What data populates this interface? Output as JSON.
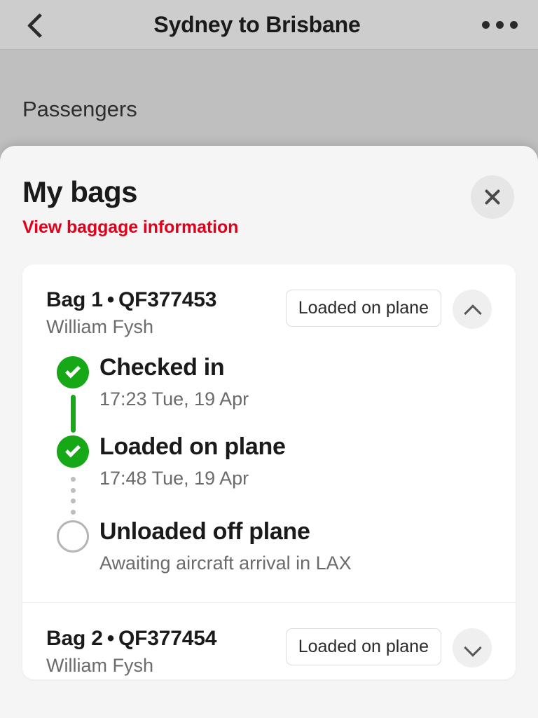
{
  "navbar": {
    "back_icon": "chevron-left-icon",
    "title": "Sydney to Brisbane",
    "more_icon": "ellipsis-icon"
  },
  "background": {
    "section_label": "Passengers"
  },
  "sheet": {
    "title": "My bags",
    "link_label": "View baggage information",
    "close_icon": "close-icon",
    "bags": [
      {
        "title": "Bag 1",
        "separator": "•",
        "tag_number": "QF377453",
        "passenger": "William Fysh",
        "status": "Loaded on plane",
        "toggle_icon": "chevron-up-icon",
        "expanded": true,
        "steps": [
          {
            "state": "done",
            "title": "Checked in",
            "detail": "17:23 Tue, 19 Apr",
            "connector": "solid"
          },
          {
            "state": "done",
            "title": "Loaded on plane",
            "detail": "17:48 Tue, 19 Apr",
            "connector": "dotted"
          },
          {
            "state": "pending",
            "title": "Unloaded off plane",
            "detail": "Awaiting aircraft arrival in LAX",
            "connector": "none"
          }
        ]
      },
      {
        "title": "Bag 2",
        "separator": "•",
        "tag_number": "QF377454",
        "passenger": "William Fysh",
        "status": "Loaded on plane",
        "toggle_icon": "chevron-down-icon",
        "expanded": false,
        "steps": []
      }
    ]
  },
  "colors": {
    "accent_red": "#e0001b",
    "status_green": "#16a816",
    "pending_gray": "#b5b5b5",
    "backdrop": "#bfbfbf",
    "sheet_bg": "#f5f5f5",
    "card_bg": "#ffffff"
  }
}
